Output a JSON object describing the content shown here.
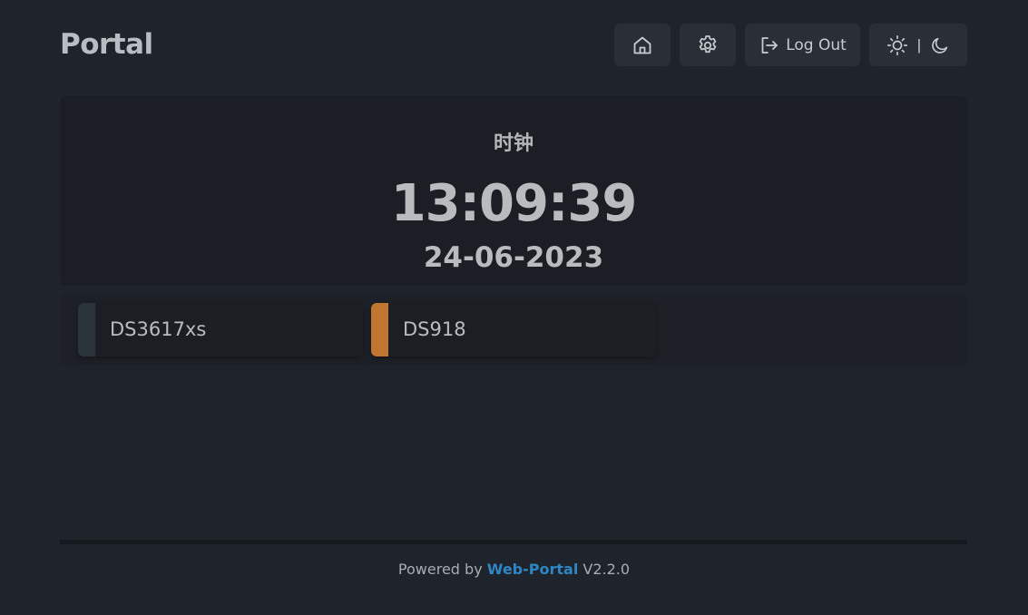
{
  "header": {
    "brand": "Portal",
    "nav": {
      "home_icon": "home-icon",
      "settings_icon": "gear-icon",
      "logout_label": "Log Out",
      "logout_icon": "logout-icon",
      "theme_separator": "|",
      "theme_light_icon": "sun-icon",
      "theme_dark_icon": "moon-icon"
    }
  },
  "clock": {
    "title": "时钟",
    "time": "13:09:39",
    "date": "24-06-2023"
  },
  "apps": [
    {
      "label": "DS3617xs",
      "color": "#2b333b"
    },
    {
      "label": "DS918",
      "color": "#c07630"
    }
  ],
  "footer": {
    "prefix": "Powered by",
    "link_text": "Web-Portal",
    "version": "V2.2.0",
    "link_color": "#2f86c4"
  }
}
